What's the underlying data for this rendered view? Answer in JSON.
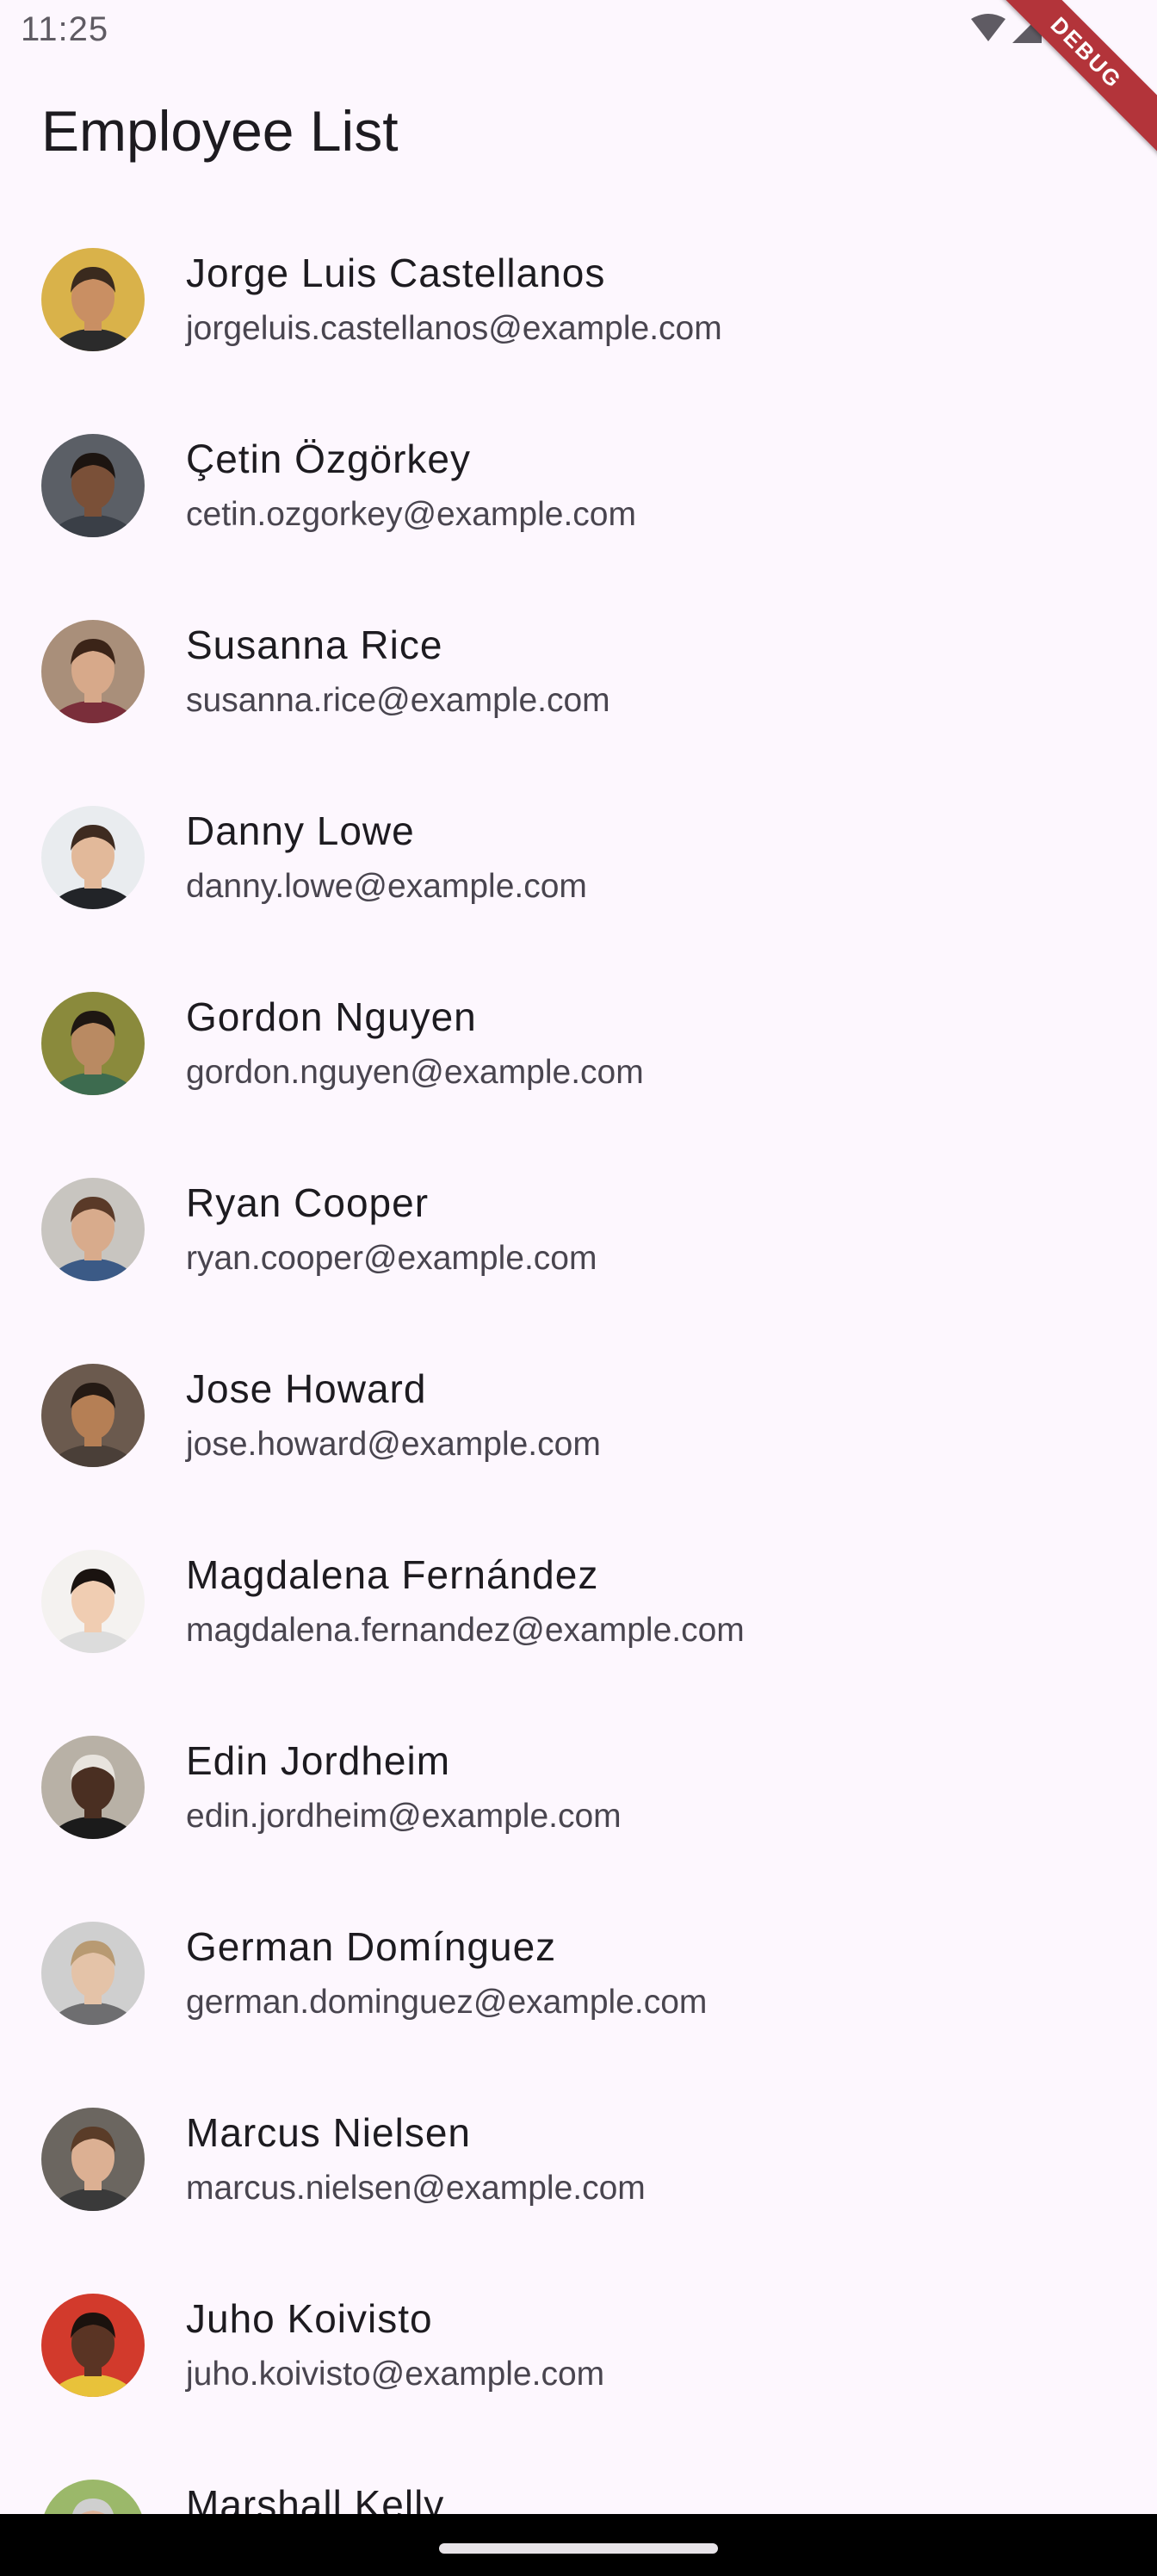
{
  "status_bar": {
    "time": "11:25",
    "icons": [
      "wifi-icon",
      "cell-signal-icon"
    ]
  },
  "debug_banner": {
    "label": "DEBUG",
    "color": "#b3343a"
  },
  "app_bar": {
    "title": "Employee List"
  },
  "employees": [
    {
      "name": "Jorge Luis Castellanos",
      "email": "jorgeluis.castellanos@example.com"
    },
    {
      "name": "Çetin Özgörkey",
      "email": "cetin.ozgorkey@example.com"
    },
    {
      "name": "Susanna Rice",
      "email": "susanna.rice@example.com"
    },
    {
      "name": "Danny Lowe",
      "email": "danny.lowe@example.com"
    },
    {
      "name": "Gordon Nguyen",
      "email": "gordon.nguyen@example.com"
    },
    {
      "name": "Ryan Cooper",
      "email": "ryan.cooper@example.com"
    },
    {
      "name": "Jose Howard",
      "email": "jose.howard@example.com"
    },
    {
      "name": "Magdalena Fernández",
      "email": "magdalena.fernandez@example.com"
    },
    {
      "name": "Edin Jordheim",
      "email": "edin.jordheim@example.com"
    },
    {
      "name": "German Domínguez",
      "email": "german.dominguez@example.com"
    },
    {
      "name": "Marcus Nielsen",
      "email": "marcus.nielsen@example.com"
    },
    {
      "name": "Juho Koivisto",
      "email": "juho.koivisto@example.com"
    },
    {
      "name": "Marshall Kelly",
      "email": ""
    }
  ],
  "avatar_colors": [
    {
      "bg": "#d9b24a",
      "skin": "#c98f63",
      "hair": "#3a2a1e",
      "shirt": "#2b2b2b"
    },
    {
      "bg": "#5b5f66",
      "skin": "#7a5038",
      "hair": "#1c1410",
      "shirt": "#3a3f47"
    },
    {
      "bg": "#a98f7a",
      "skin": "#d7a98a",
      "hair": "#3b2418",
      "shirt": "#7a2e3a"
    },
    {
      "bg": "#e9ecef",
      "skin": "#e2b99a",
      "hair": "#3e2b20",
      "shirt": "#222428"
    },
    {
      "bg": "#8a8a3c",
      "skin": "#b98a62",
      "hair": "#1e1712",
      "shirt": "#3d6b4f"
    },
    {
      "bg": "#c8c5c0",
      "skin": "#d8ab8c",
      "hair": "#5a3a28",
      "shirt": "#3b5a86"
    },
    {
      "bg": "#6b5a4e",
      "skin": "#b57f55",
      "hair": "#241a14",
      "shirt": "#4a3f38"
    },
    {
      "bg": "#f4f2f0",
      "skin": "#f0cdb2",
      "hair": "#1a1310",
      "shirt": "#dcdcdc"
    },
    {
      "bg": "#b8b1a6",
      "skin": "#4a2f22",
      "hair": "#e8e4de",
      "shirt": "#1b1b1b"
    },
    {
      "bg": "#cfcfcf",
      "skin": "#e4c3a8",
      "hair": "#b89a72",
      "shirt": "#6e6e70"
    },
    {
      "bg": "#6b6660",
      "skin": "#dcb093",
      "hair": "#5a3c28",
      "shirt": "#3a3a3a"
    },
    {
      "bg": "#d23a2c",
      "skin": "#5a3424",
      "hair": "#1a120e",
      "shirt": "#e8c23a"
    },
    {
      "bg": "#9bb86a",
      "skin": "#e0b59a",
      "hair": "#cfcfcf",
      "shirt": "#4a4a4a"
    }
  ]
}
